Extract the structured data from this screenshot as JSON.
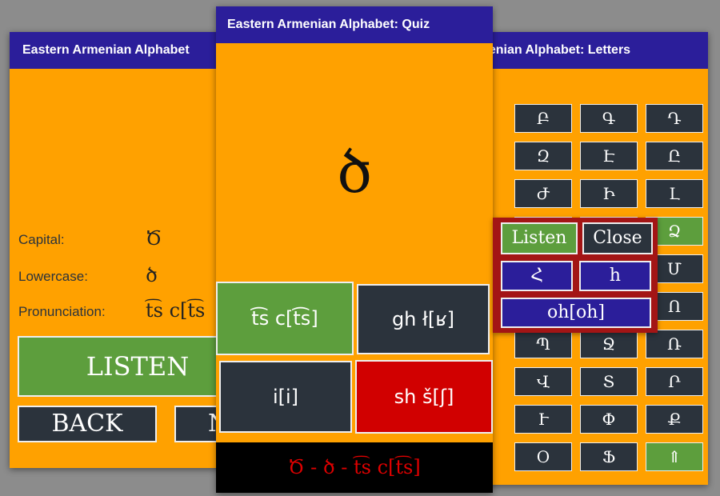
{
  "windows": {
    "letters": {
      "title": "rn Armenian Alphabet: Letters",
      "grid": [
        [
          "",
          "Բ",
          "Գ",
          "Դ"
        ],
        [
          "",
          "Զ",
          "Է",
          "Ը"
        ],
        [
          "",
          "Ժ",
          "Ի",
          "Լ"
        ],
        [
          "",
          "",
          "",
          "Ձ"
        ],
        [
          "",
          "",
          "",
          "Մ"
        ],
        [
          "",
          "",
          "",
          "Ո"
        ],
        [
          "",
          "Պ",
          "Ջ",
          "Ռ"
        ],
        [
          "",
          "Վ",
          "Տ",
          "Ր"
        ],
        [
          "",
          "Ւ",
          "Փ",
          "Ք"
        ],
        [
          "",
          "Օ",
          "Ֆ",
          "⇑"
        ]
      ]
    },
    "detail": {
      "title": "Eastern Armenian Alphabet",
      "capital_label": "Capital:",
      "capital_value": "Ծ",
      "lowercase_label": "Lowercase:",
      "lowercase_value": "ծ",
      "pronunciation_label": "Pronunciation:",
      "pronunciation_value": "t͡s c[t͡s",
      "listen_label": "LISTEN",
      "back_label": "BACK",
      "next_label": "N"
    },
    "quiz": {
      "title": "Eastern Armenian Alphabet: Quiz",
      "letter": "ծ",
      "options": [
        "t͡s c[t͡s]",
        "gh ł[ʁ]",
        "i[i]",
        "sh š[ʃ]"
      ],
      "feedback": "Ծ - ծ - t͡s c[t͡s]"
    }
  },
  "popup": {
    "listen_label": "Listen",
    "close_label": "Close",
    "capital": "Հ",
    "lowercase": "հ",
    "pronunciation": "oh[oh]"
  },
  "colors": {
    "title_bar": "#2b1e9a",
    "background": "#ffa100",
    "button_dark": "#2b333c",
    "button_green": "#5d9e3d",
    "button_red": "#d10000",
    "popup_border": "#a31515"
  }
}
